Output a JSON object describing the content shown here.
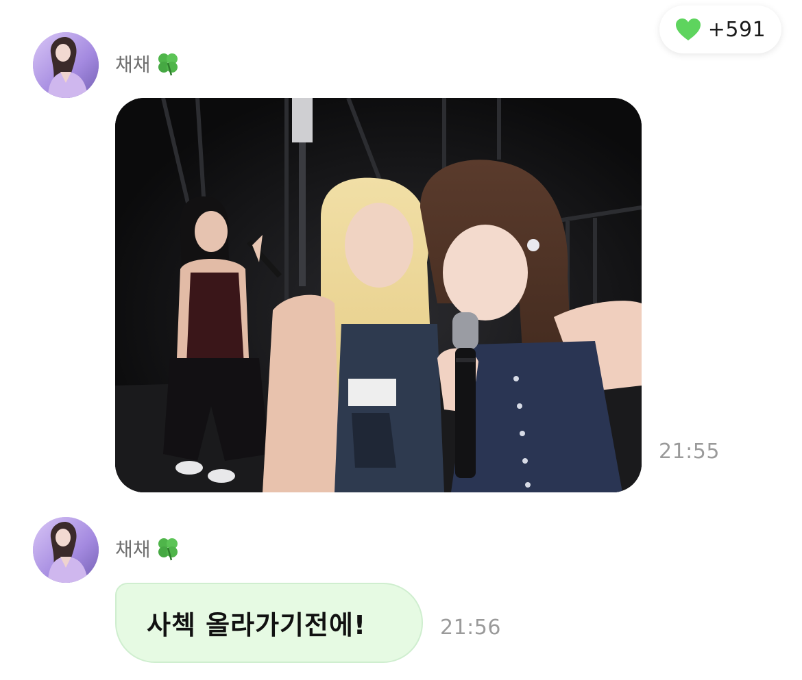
{
  "reaction": {
    "icon": "green-heart-icon",
    "count": "+591",
    "color": "#5ed45e"
  },
  "messages": [
    {
      "sender": "채채",
      "sender_badge": "four-leaf-clover-icon",
      "type": "photo",
      "time": "21:55"
    },
    {
      "sender": "채채",
      "sender_badge": "four-leaf-clover-icon",
      "type": "text",
      "text": "사첵 올라가기전에!",
      "time": "21:56"
    }
  ],
  "colors": {
    "bubble_background": "#e6fae3",
    "bubble_border": "#cfeecf",
    "timestamp": "#9a9a9a",
    "sender_name": "#6f6f6f"
  }
}
